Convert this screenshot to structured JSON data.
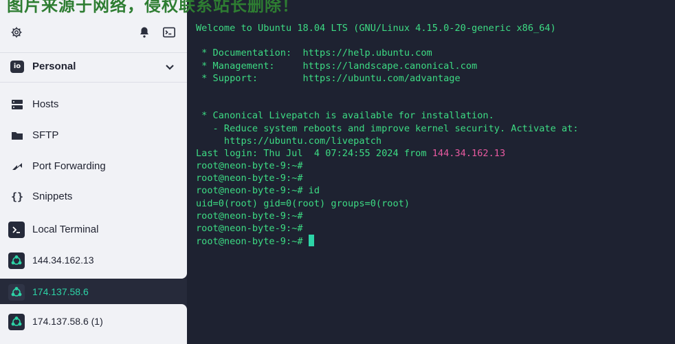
{
  "watermark": "图片来源于网络，侵权联系站长删除！",
  "sidebar": {
    "vault_name": "Personal",
    "nav_items": [
      {
        "label": "Hosts",
        "icon": "hosts-icon"
      },
      {
        "label": "SFTP",
        "icon": "folder-icon"
      },
      {
        "label": "Port Forwarding",
        "icon": "port-forwarding-icon"
      },
      {
        "label": "Snippets",
        "icon": "snippets-icon"
      }
    ],
    "local_terminal": "Local Terminal",
    "hosts": [
      "144.34.162.13",
      "174.137.58.6",
      "174.137.58.6 (1)"
    ],
    "active_host_index": 1
  },
  "colors": {
    "terminal_text": "#3ddc84",
    "ip_highlight": "#e85aa0",
    "accent": "#2dd4a7",
    "terminal_bg": "#1e2231"
  },
  "terminal": {
    "lines": [
      "Welcome to Ubuntu 18.04 LTS (GNU/Linux 4.15.0-20-generic x86_64)",
      "",
      " * Documentation:  https://help.ubuntu.com",
      " * Management:     https://landscape.canonical.com",
      " * Support:        https://ubuntu.com/advantage",
      "",
      "",
      " * Canonical Livepatch is available for installation.",
      "   - Reduce system reboots and improve kernel security. Activate at:",
      "     https://ubuntu.com/livepatch"
    ],
    "last_login_prefix": "Last login: Thu Jul  4 07:24:55 2024 from ",
    "last_login_ip": "144.34.162.13",
    "after_lines": [
      "root@neon-byte-9:~#",
      "root@neon-byte-9:~#",
      "root@neon-byte-9:~# id",
      "uid=0(root) gid=0(root) groups=0(root)",
      "root@neon-byte-9:~#",
      "root@neon-byte-9:~#"
    ],
    "prompt": "root@neon-byte-9:~# "
  }
}
